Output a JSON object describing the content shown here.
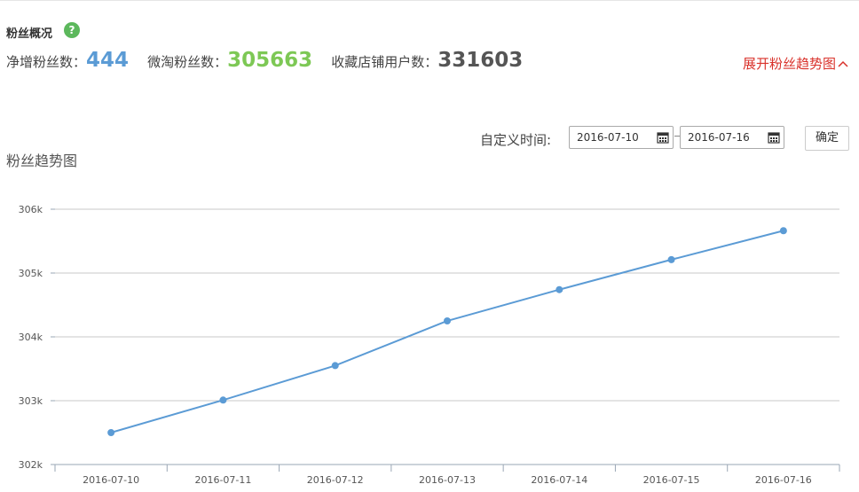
{
  "overview": {
    "title": "粉丝概况",
    "help_icon": "question-circle-icon",
    "stats": [
      {
        "label": "净增粉丝数：",
        "value": "444",
        "color": "#5b9bd5"
      },
      {
        "label": "微淘粉丝数：",
        "value": "305663",
        "color": "#7dc855"
      },
      {
        "label": "收藏店铺用户数：",
        "value": "331603",
        "color": "#555555"
      }
    ],
    "expand_label": "展开粉丝趋势图",
    "expand_icon": "chevron-up-icon"
  },
  "filter": {
    "label": "自定义时间:",
    "start_date": "2016-07-10",
    "end_date": "2016-07-16",
    "calendar_icon": "calendar-icon",
    "confirm_label": "确定"
  },
  "chart_data": {
    "type": "line",
    "title": "粉丝趋势图",
    "xlabel": "",
    "ylabel": "",
    "categories": [
      "2016-07-10",
      "2016-07-11",
      "2016-07-12",
      "2016-07-13",
      "2016-07-14",
      "2016-07-15",
      "2016-07-16"
    ],
    "values": [
      302500,
      303010,
      303550,
      304250,
      304740,
      305210,
      305663
    ],
    "ylim": [
      302000,
      306000
    ],
    "yticks": [
      302000,
      303000,
      304000,
      305000,
      306000
    ],
    "ytick_labels": [
      "302k",
      "303k",
      "304k",
      "305k",
      "306k"
    ],
    "grid": true,
    "line_color": "#5b9bd5"
  }
}
